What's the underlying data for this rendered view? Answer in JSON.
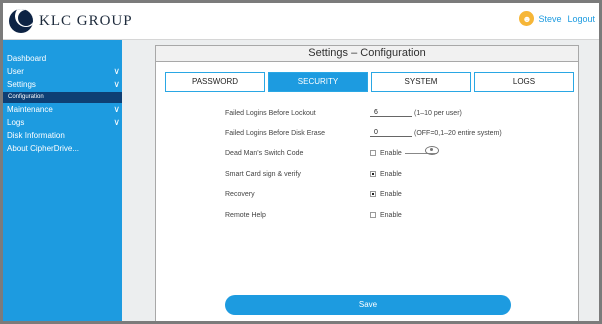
{
  "header": {
    "logo_text": "KLC GROUP",
    "user_name": "Steve",
    "logout_label": "Logout",
    "avatar_glyph": "☻"
  },
  "sidebar": {
    "items": [
      {
        "label": "Dashboard",
        "has_chevron": false
      },
      {
        "label": "User",
        "has_chevron": true
      },
      {
        "label": "Settings",
        "has_chevron": true
      },
      {
        "label": "Configuration",
        "has_chevron": false,
        "sub": true,
        "active": true
      },
      {
        "label": "Maintenance",
        "has_chevron": true
      },
      {
        "label": "Logs",
        "has_chevron": true
      },
      {
        "label": "Disk Information",
        "has_chevron": false
      },
      {
        "label": "About CipherDrive...",
        "has_chevron": false
      }
    ],
    "chevron_glyph": "∨"
  },
  "panel": {
    "title": "Settings – Configuration",
    "tabs": [
      {
        "label": "PASSWORD",
        "active": false
      },
      {
        "label": "SECURITY",
        "active": true
      },
      {
        "label": "SYSTEM",
        "active": false
      },
      {
        "label": "LOGS",
        "active": false
      }
    ]
  },
  "security": {
    "failed_logins_lockout": {
      "label": "Failed Logins Before Lockout",
      "value": "6",
      "hint": "(1–10 per user)"
    },
    "failed_logins_erase": {
      "label": "Failed Logins Before Disk Erase",
      "value": "0",
      "hint": "(OFF=0,1–20 entire system)"
    },
    "dead_mans_switch": {
      "label": "Dead Man's Switch Code",
      "enable_label": "Enable",
      "checked": false
    },
    "smart_card": {
      "label": "Smart Card sign & verify",
      "enable_label": "Enable",
      "checked": true
    },
    "recovery": {
      "label": "Recovery",
      "enable_label": "Enable",
      "checked": true
    },
    "remote_help": {
      "label": "Remote Help",
      "enable_label": "Enable",
      "checked": false
    }
  },
  "actions": {
    "save_label": "Save"
  },
  "colors": {
    "accent": "#1d9be0",
    "sidebar_active": "#0e3f74",
    "logo_dark": "#0d2344",
    "avatar": "#f6b637"
  }
}
